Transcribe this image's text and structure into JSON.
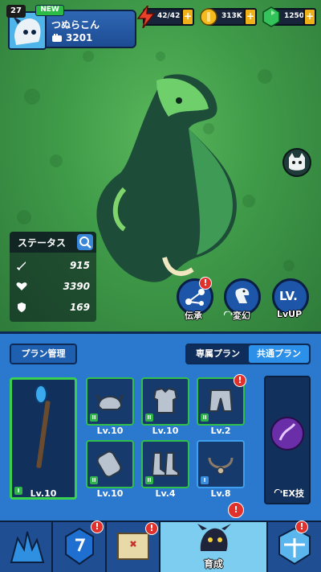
{
  "player": {
    "level": "27",
    "new_badge": "NEW",
    "name": "つぬらこん",
    "power": "3201"
  },
  "resources": [
    {
      "name": "energy",
      "icon": "lightning-icon",
      "value": "42/42"
    },
    {
      "name": "coins",
      "icon": "coin-icon",
      "value": "313K"
    },
    {
      "name": "gems",
      "icon": "gem-icon",
      "value": "1250"
    }
  ],
  "resource_plus": "+",
  "stats": {
    "title": "ステータス",
    "rows": [
      {
        "icon": "sword-icon",
        "value": "915"
      },
      {
        "icon": "heart-icon",
        "value": "3390"
      },
      {
        "icon": "shield-icon",
        "value": "169"
      }
    ]
  },
  "actions": {
    "inherit": "伝承",
    "transform": "変幻",
    "lvup_icon_text": "LV.",
    "lvup": "LvUP",
    "alert": "!"
  },
  "panel": {
    "plan_manage": "プラン管理",
    "tabs": [
      "専属プラン",
      "共通プラン"
    ],
    "active_tab": 1,
    "weapon": {
      "level": "Lv.10",
      "rank": "I"
    },
    "slots": [
      {
        "name": "helmet",
        "level": "Lv.10",
        "rank": "II"
      },
      {
        "name": "armor",
        "level": "Lv.10",
        "rank": "II"
      },
      {
        "name": "pants",
        "level": "Lv.2",
        "rank": "II"
      },
      {
        "name": "bracer",
        "level": "Lv.10",
        "rank": "II"
      },
      {
        "name": "boots",
        "level": "Lv.4",
        "rank": "II"
      },
      {
        "name": "necklace",
        "level": "Lv.8",
        "rank": "I"
      }
    ],
    "ex_skill": "EX技"
  },
  "nav": {
    "active_label": "育成"
  },
  "colors": {
    "accent_blue": "#2b79cf",
    "alert_red": "#e0312d",
    "rank_green": "#2fb34a",
    "background_green": "#3f9a48"
  }
}
